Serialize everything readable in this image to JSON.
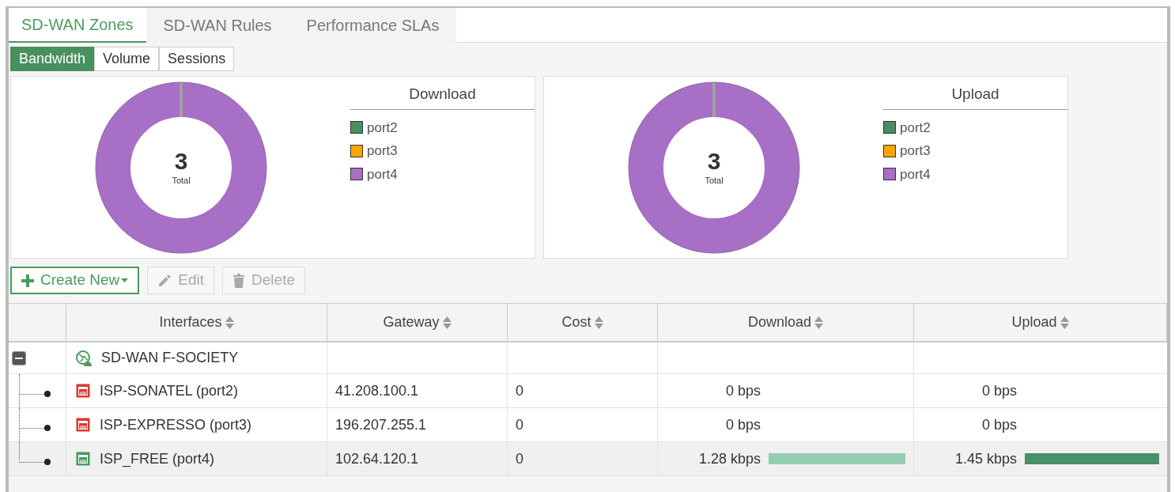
{
  "tabs": [
    {
      "label": "SD-WAN Zones",
      "selected": true
    },
    {
      "label": "SD-WAN Rules",
      "selected": false
    },
    {
      "label": "Performance SLAs",
      "selected": false
    }
  ],
  "view_tabs": [
    {
      "label": "Bandwidth",
      "selected": true
    },
    {
      "label": "Volume",
      "selected": false
    },
    {
      "label": "Sessions",
      "selected": false
    }
  ],
  "charts": [
    {
      "title": "Download",
      "total": "3",
      "total_label": "Total",
      "legend": [
        {
          "label": "port2",
          "color": "#4a8f5e"
        },
        {
          "label": "port3",
          "color": "#ffa500"
        },
        {
          "label": "port4",
          "color": "#a86fc6"
        }
      ]
    },
    {
      "title": "Upload",
      "total": "3",
      "total_label": "Total",
      "legend": [
        {
          "label": "port2",
          "color": "#4a8f5e"
        },
        {
          "label": "port3",
          "color": "#ffa500"
        },
        {
          "label": "port4",
          "color": "#a86fc6"
        }
      ]
    }
  ],
  "toolbar": [
    {
      "kind": "create",
      "label": "Create New",
      "disabled": false
    },
    {
      "kind": "edit",
      "label": "Edit",
      "disabled": true
    },
    {
      "kind": "delete",
      "label": "Delete",
      "disabled": true
    }
  ],
  "table": {
    "columns": [
      "Interfaces",
      "Gateway",
      "Cost",
      "Download",
      "Upload"
    ],
    "rows": [
      {
        "expanded": true,
        "name": "SD-WAN F-SOCIETY",
        "selected": false,
        "children": [
          {
            "name": "ISP-SONATEL (port2)",
            "color": "#d9382f",
            "gateway": "41.208.100.1",
            "cost": "0",
            "download": {
              "reading": "0 bps"
            },
            "upload": {
              "reading": "0 bps"
            },
            "selected": false
          },
          {
            "name": "ISP-EXPRESSO (port3)",
            "color": "#d9382f",
            "gateway": "196.207.255.1",
            "cost": "0",
            "download": {
              "reading": "0 bps"
            },
            "upload": {
              "reading": "0 bps"
            },
            "selected": false
          },
          {
            "name": "ISP_FREE (port4)",
            "color": "#4a9a5e",
            "gateway": "102.64.120.1",
            "cost": "0",
            "download": {
              "reading": "1.28 kbps",
              "bar": true
            },
            "upload": {
              "reading": "1.45 kbps",
              "bar": true
            },
            "selected": true
          }
        ]
      }
    ]
  }
}
